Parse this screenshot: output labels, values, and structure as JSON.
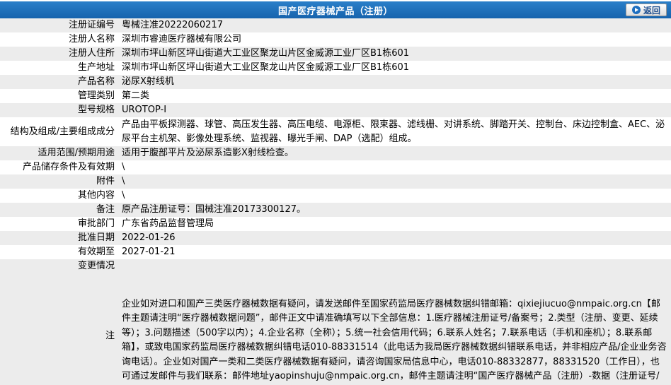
{
  "header": {
    "title": "国产医疗器械产品（注册）",
    "back_label": "返回"
  },
  "rows": [
    {
      "label": "注册证编号",
      "value": "粤械注准20222060217"
    },
    {
      "label": "注册人名称",
      "value": "深圳市睿迪医疗器械有限公司"
    },
    {
      "label": "注册人住所",
      "value": "深圳市坪山新区坪山街道大工业区聚龙山片区金威源工业厂区B1栋601"
    },
    {
      "label": "生产地址",
      "value": "深圳市坪山新区坪山街道大工业区聚龙山片区金威源工业厂区B1栋601"
    },
    {
      "label": "产品名称",
      "value": "泌尿X射线机"
    },
    {
      "label": "管理类别",
      "value": "第二类"
    },
    {
      "label": "型号规格",
      "value": "UROTOP-I"
    },
    {
      "label": "结构及组成/主要组成成分",
      "value": "产品由平板探测器、球管、高压发生器、高压电缆、电源柜、限束器、滤线栅、对讲系统、脚踏开关、控制台、床边控制盒、AEC、泌尿平台主机架、影像处理系统、监视器、曝光手闸、DAP（选配）组成。"
    },
    {
      "label": "适用范围/预期用途",
      "value": "适用于腹部平片及泌尿系造影X射线检查。"
    },
    {
      "label": "产品储存条件及有效期",
      "value": "\\"
    },
    {
      "label": "附件",
      "value": "\\"
    },
    {
      "label": "其他内容",
      "value": "\\"
    },
    {
      "label": "备注",
      "value": "原产品注册证号：国械注准20173300127。"
    },
    {
      "label": "审批部门",
      "value": "广东省药品监督管理局"
    },
    {
      "label": "批准日期",
      "value": "2022-01-26"
    },
    {
      "label": "有效期至",
      "value": "2027-01-21"
    },
    {
      "label": "变更情况",
      "value": ""
    }
  ],
  "note": {
    "label": "注",
    "text": "企业如对进口和国产三类医疗器械数据有疑问，请发送邮件至国家药监局医疗器械数据纠错邮箱：qixiejiucuo@nmpaic.org.cn【邮件主题请注明“医疗器械数据问题”，邮件正文中请准确填写以下全部信息：1.医疗器械注册证号/备案号；2.类型（注册、变更、延续等）；3.问题描述（500字以内）；4.企业名称（全称）；5.统一社会信用代码；6.联系人姓名；7.联系电话（手机和座机）；8.联系邮箱】，或致电国家药监局医疗器械数据纠错电话010-88331514（此电话为我局医疗器械数据纠错联系电话，并非相应产品/企业业务咨询电话）。企业如对国产一类和二类医疗器械数据有疑问，请咨询国家局信息中心，电话010-88332877，88331520（工作日），也可通过发邮件与我们联系：邮件地址yaopinshuju@nmpaic.org.cn，邮件主题请注明“国产医疗器械产品（注册）-数据（注册证号/备案号）数据问题”。国产一类和二类医疗器械数据来源于省局，由省局通过数据共享平台进行纠错和维护。"
  }
}
